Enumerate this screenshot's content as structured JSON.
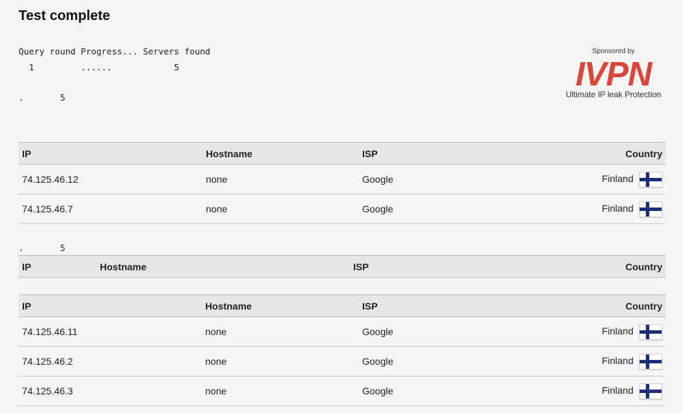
{
  "page": {
    "title": "Test complete"
  },
  "progress": {
    "header": "Query round Progress... Servers found",
    "row": "  1         ......            5"
  },
  "dots": {
    "line1": ".       5",
    "line2": ".       5"
  },
  "sponsor": {
    "label": "Sponsored by",
    "brand": "IVPN",
    "tagline": "Ultimate IP leak Protection",
    "brand_color": "#d9463a"
  },
  "columns": {
    "ip": "IP",
    "hostname": "Hostname",
    "isp": "ISP",
    "country": "Country"
  },
  "table1": {
    "rows": [
      {
        "ip": "74.125.46.12",
        "hostname": "none",
        "isp": "Google",
        "country": "Finland",
        "flag": "finland-flag-icon"
      },
      {
        "ip": "74.125.46.7",
        "hostname": "none",
        "isp": "Google",
        "country": "Finland",
        "flag": "finland-flag-icon"
      }
    ]
  },
  "table3": {
    "rows": [
      {
        "ip": "74.125.46.11",
        "hostname": "none",
        "isp": "Google",
        "country": "Finland",
        "flag": "finland-flag-icon"
      },
      {
        "ip": "74.125.46.2",
        "hostname": "none",
        "isp": "Google",
        "country": "Finland",
        "flag": "finland-flag-icon"
      },
      {
        "ip": "74.125.46.3",
        "hostname": "none",
        "isp": "Google",
        "country": "Finland",
        "flag": "finland-flag-icon"
      }
    ]
  }
}
